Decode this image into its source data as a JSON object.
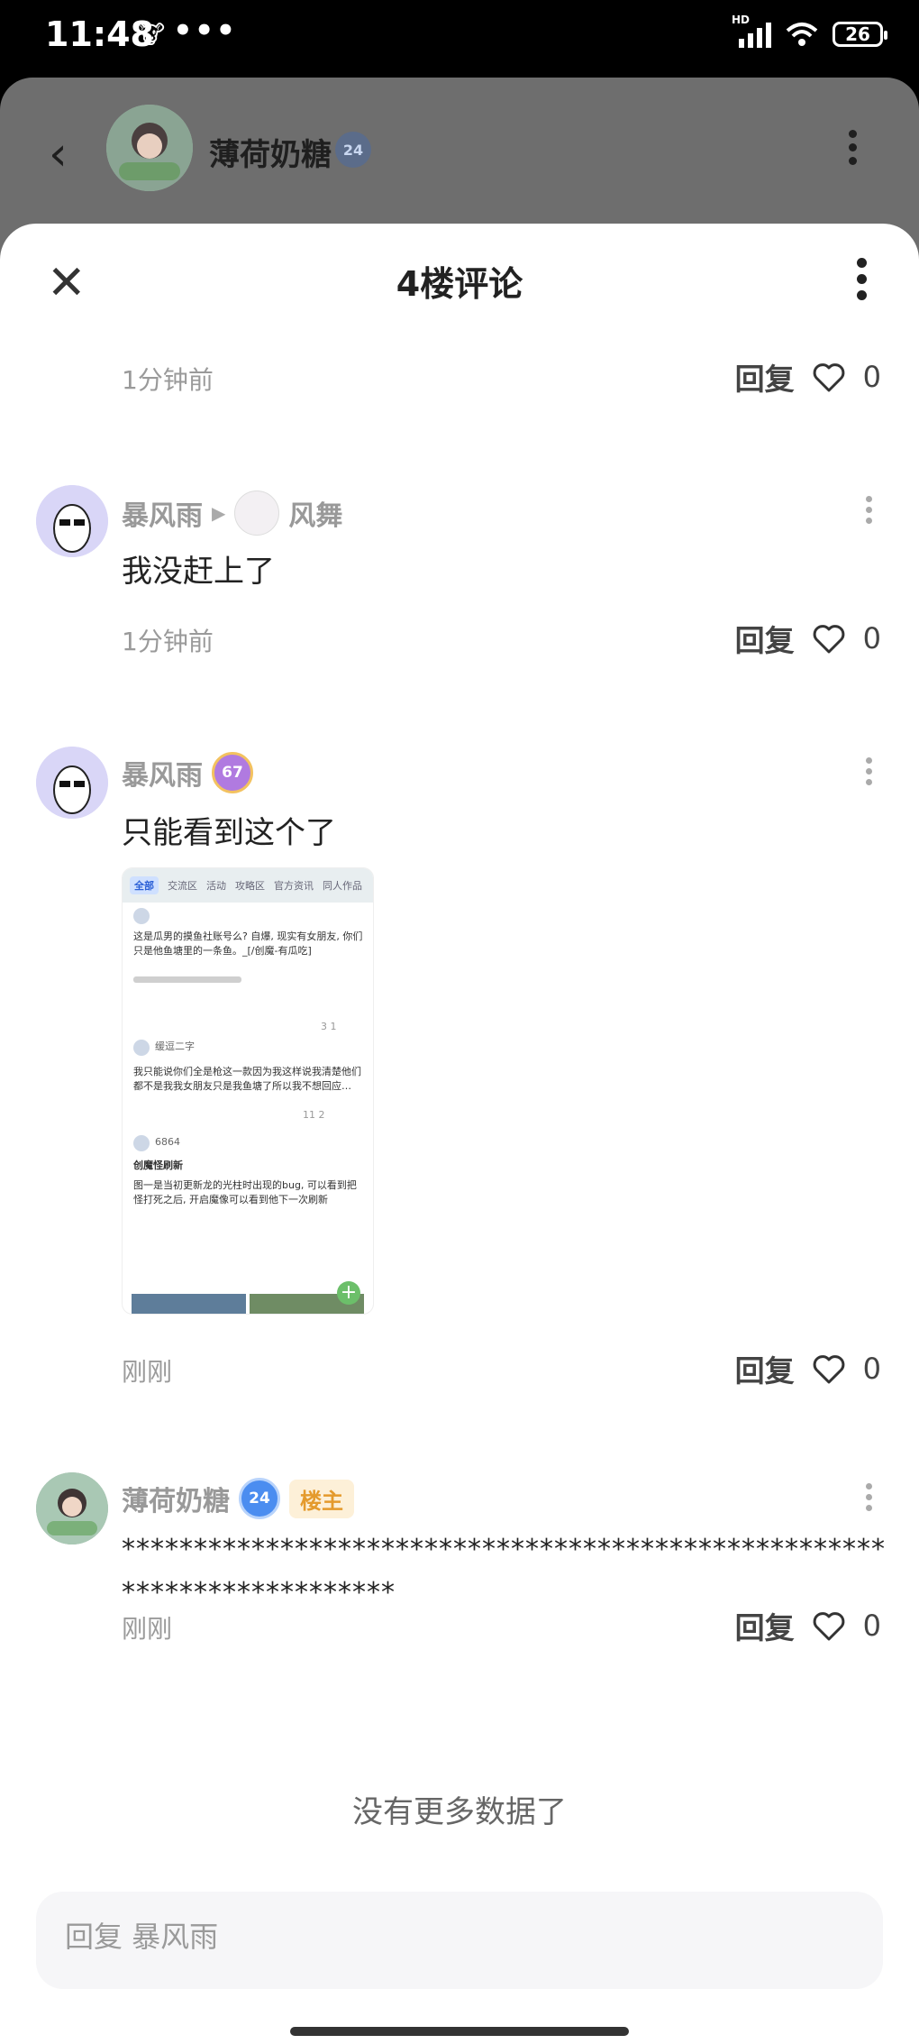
{
  "status_bar": {
    "time": "11:48",
    "notification_icon": "app-notification-icon",
    "more": "•••",
    "battery": "26",
    "network": "HD"
  },
  "background_header": {
    "name": "薄荷奶糖",
    "level": "24"
  },
  "sheet": {
    "title": "4楼评论"
  },
  "top_meta": {
    "time": "1分钟前",
    "reply": "回复",
    "likes": "0"
  },
  "comments": [
    {
      "name": "暴风雨",
      "reply_to": "风舞",
      "text": "我没赶上了",
      "time": "1分钟前",
      "reply": "回复",
      "likes": "0"
    },
    {
      "name": "暴风雨",
      "level": "67",
      "text": "只能看到这个了",
      "time": "刚刚",
      "reply": "回复",
      "likes": "0",
      "screenshot": {
        "tabs": [
          "全部",
          "交流区",
          "活动",
          "攻略区",
          "官方资讯",
          "同人作品"
        ],
        "post1": "这是瓜男的摸鱼社账号么? 自爆, 现实有女朋友, 你们只是他鱼塘里的一条鱼。_[/创魔-有瓜吃]",
        "post1_stats": "3  1",
        "post2_user": "缓逗二字",
        "post2": "我只能说你们全是枪这一款因为我这样说我清楚他们都不是我我女朋友只是我鱼塘了所以我不想回应…",
        "post2_stats": "11  2",
        "post3_user": "6864",
        "post3_title": "创魔怪刷新",
        "post3": "图一是当初更新龙的光柱时出现的bug, 可以看到把怪打死之后, 开启魔像可以看到他下一次刷新"
      }
    },
    {
      "name": "薄荷奶糖",
      "level": "24",
      "op_tag": "楼主",
      "text": "************************************************************************",
      "time": "刚刚",
      "reply": "回复",
      "likes": "0"
    }
  ],
  "footer": {
    "no_more": "没有更多数据了",
    "reply_placeholder": "回复 暴风雨"
  }
}
